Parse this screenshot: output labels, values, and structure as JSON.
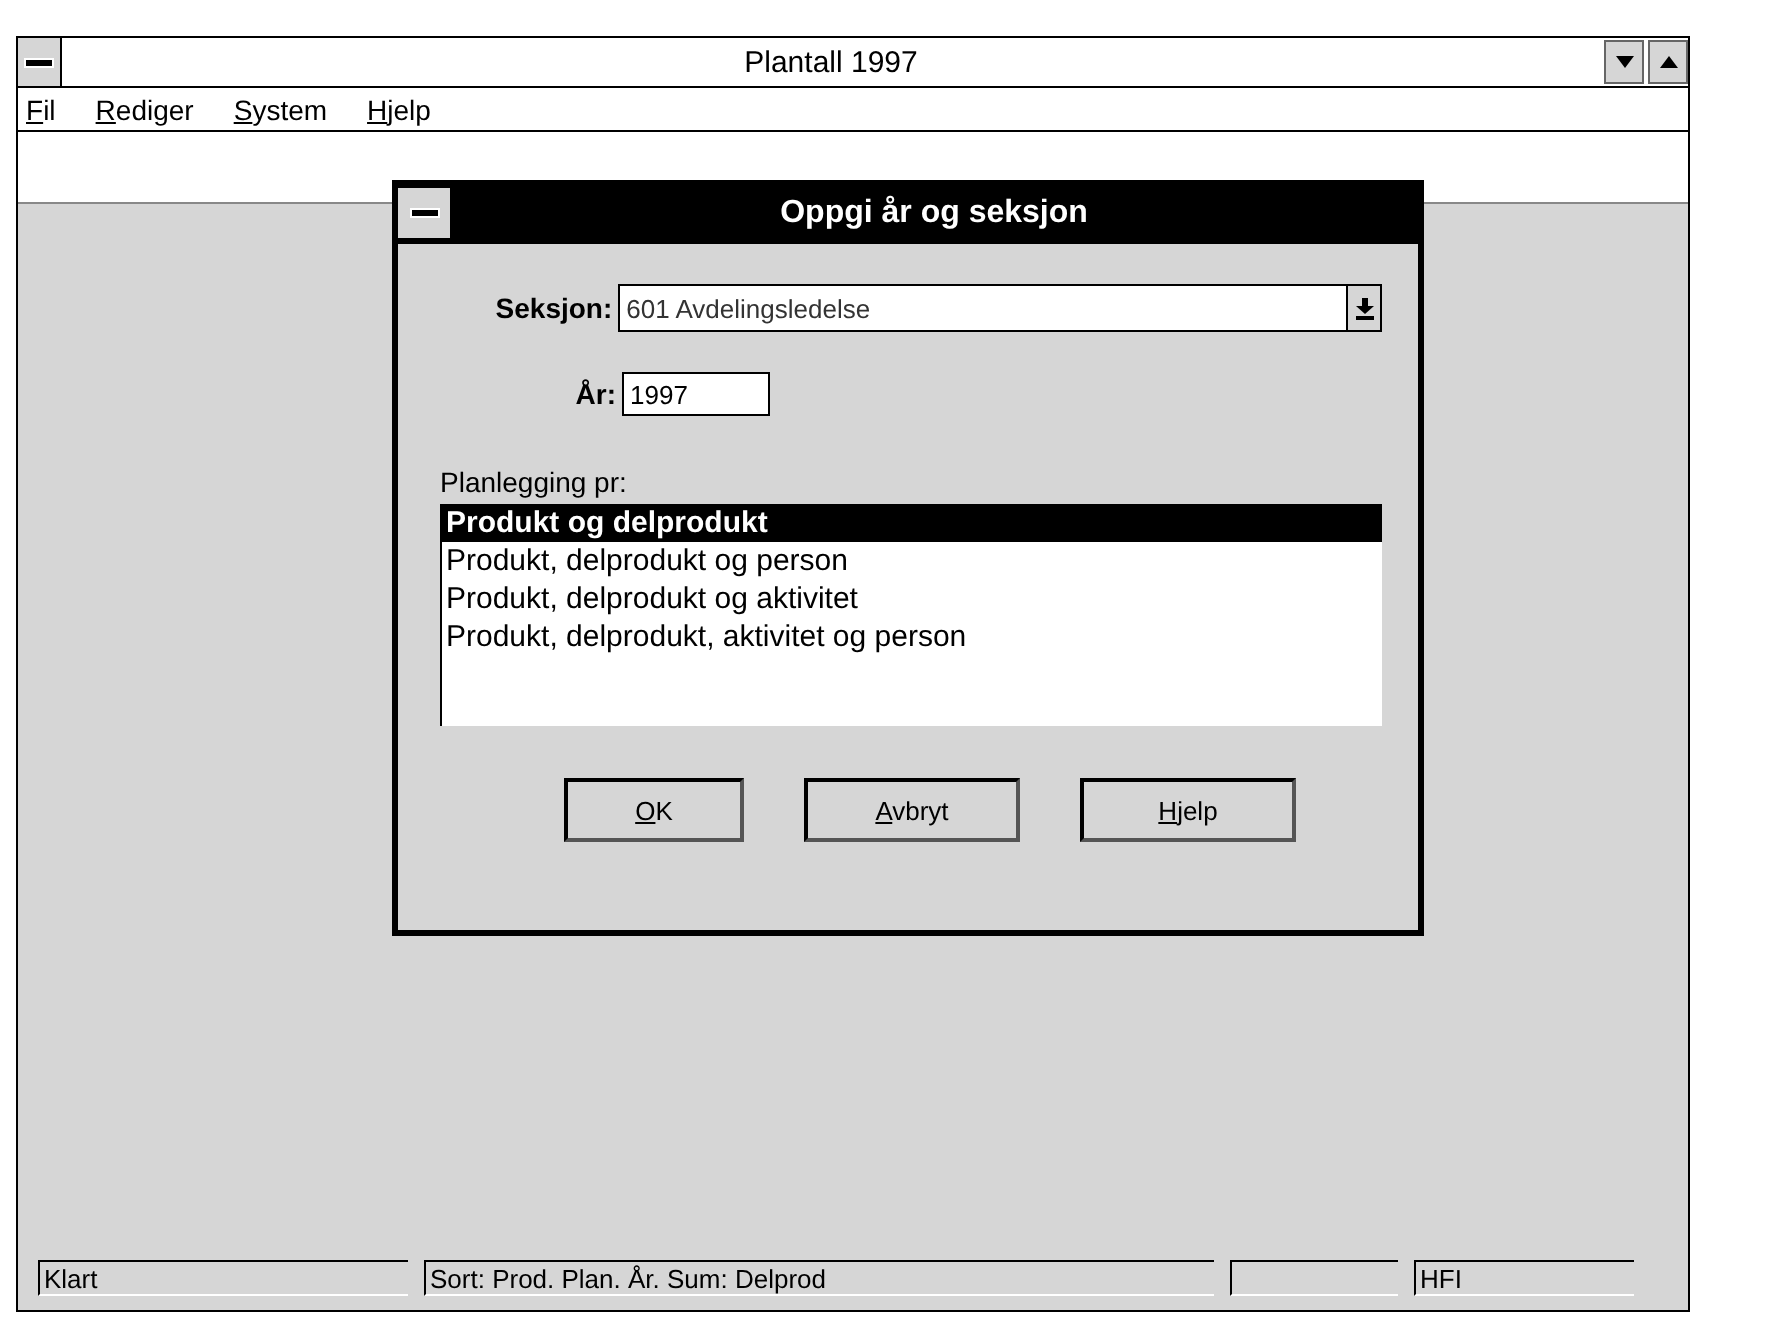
{
  "window": {
    "title": "Plantall 1997"
  },
  "menu": [
    {
      "label": "Fil",
      "underline_first": true
    },
    {
      "label": "Rediger",
      "underline_first": true
    },
    {
      "label": "System",
      "underline_first": true
    },
    {
      "label": "Hjelp",
      "underline_first": true
    }
  ],
  "dialog": {
    "title": "Oppgi år og seksjon",
    "section": {
      "label": "Seksjon:",
      "value": "601 Avdelingsledelse"
    },
    "year": {
      "label": "År:",
      "value": "1997"
    },
    "list_label": "Planlegging pr:",
    "options": [
      {
        "label": "Produkt og delprodukt",
        "selected": true
      },
      {
        "label": "Produkt, delprodukt og person",
        "selected": false
      },
      {
        "label": "Produkt, delprodukt og aktivitet",
        "selected": false
      },
      {
        "label": "Produkt, delprodukt, aktivitet og person",
        "selected": false
      }
    ],
    "buttons": [
      {
        "label": "OK",
        "underline_first": true
      },
      {
        "label": "Avbryt",
        "underline_first": true
      },
      {
        "label": "Hjelp",
        "underline_first": true
      }
    ]
  },
  "status_bar": [
    {
      "kind": "text",
      "text": "Klart"
    },
    {
      "kind": "text",
      "text": "Sort: Prod. Plan. År. Sum: Delprod"
    },
    {
      "kind": "blank"
    },
    {
      "kind": "text",
      "text": "HFI"
    }
  ]
}
